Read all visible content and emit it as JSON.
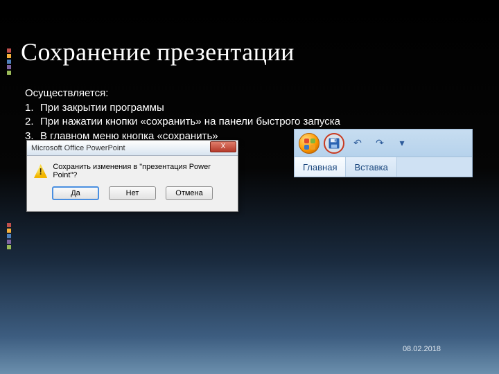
{
  "title": "Сохранение  презентации",
  "intro": "Осуществляется:",
  "list": [
    {
      "n": "1.",
      "t": "При закрытии программы"
    },
    {
      "n": "2.",
      "t": "При нажатии кнопки «сохранить» на панели быстрого запуска"
    },
    {
      "n": "3.",
      "t": "В  главном меню кнопка «сохранить»"
    }
  ],
  "dialog": {
    "appname": "Microsoft Office PowerPoint",
    "close_glyph": "X",
    "warn_glyph": "!",
    "message": "Сохранить изменения в \"презентация Power Point\"?",
    "yes": "Да",
    "no": "Нет",
    "cancel": "Отмена"
  },
  "ribbon": {
    "undo_glyph": "↶",
    "redo_glyph": "↷",
    "dropdown_glyph": "▾",
    "tab_home": "Главная",
    "tab_insert": "Вставка"
  },
  "footer": {
    "date": "08.02.2018"
  },
  "colors": {
    "highlight_ring": "#c83a20"
  }
}
